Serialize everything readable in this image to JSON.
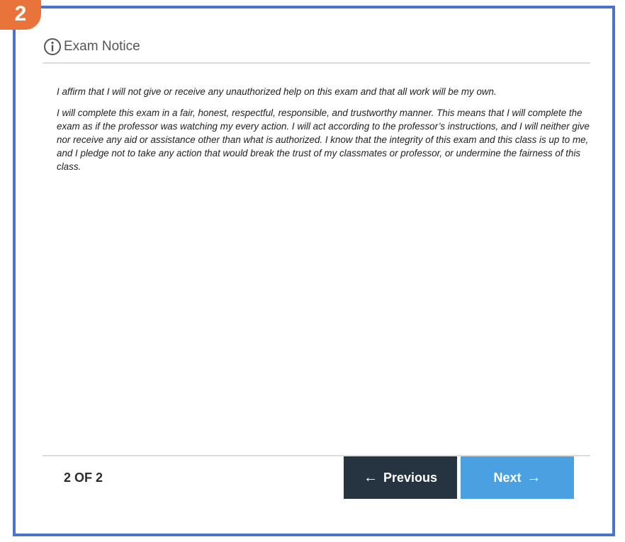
{
  "step_badge": "2",
  "header": {
    "icon": "info-circle-icon",
    "title": "Exam Notice"
  },
  "notice": {
    "paragraphs": [
      "I affirm that I will not give or receive any unauthorized help on this exam and that all work will be my own.",
      "I will complete this exam in a fair, honest, respectful, responsible, and trustworthy manner. This means that I will complete the exam as if the professor was watching my every action. I will act according to the professor’s instructions, and I will neither give nor receive any aid or assistance other than what is authorized. I know that the integrity of this exam and this class is up to me, and I pledge not to take any action that would break the trust of my classmates or professor, or undermine the fairness of this class."
    ]
  },
  "footer": {
    "page_counter": "2 OF 2",
    "previous_label": "Previous",
    "next_label": "Next",
    "previous_arrow": "←",
    "next_arrow": "→"
  },
  "colors": {
    "frame_border": "#4a74c9",
    "badge": "#e8743b",
    "previous_button": "#263341",
    "next_button": "#4aa0e0"
  }
}
